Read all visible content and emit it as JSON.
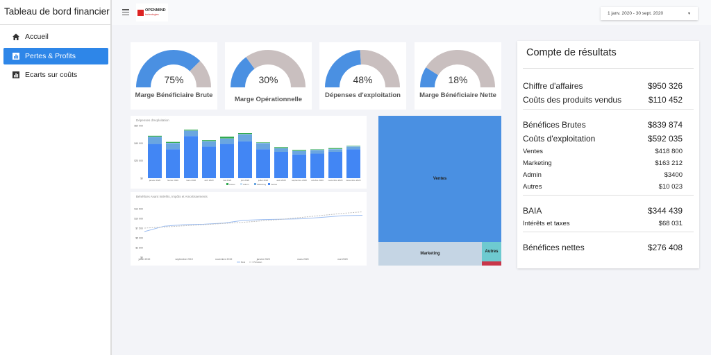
{
  "sidebar": {
    "title": "Tableau de bord financier",
    "items": [
      {
        "label": "Accueil",
        "icon": "home-icon"
      },
      {
        "label": "Pertes & Profits",
        "icon": "bar-chart-icon",
        "active": true
      },
      {
        "label": "Ecarts sur coûts",
        "icon": "bar-chart-icon"
      }
    ]
  },
  "header": {
    "logo_text": "OPENMIND",
    "logo_sub": "technologies",
    "date_range": "1 janv. 2020 - 30 sept. 2020"
  },
  "gauges": [
    {
      "label": "Marge Bénéficiaire Brute",
      "value_label": "75%",
      "value": 75
    },
    {
      "label": "Marge Opérationnelle",
      "value_label": "30%",
      "value": 30
    },
    {
      "label": "Dépenses d'exploitation",
      "value_label": "48%",
      "value": 48
    },
    {
      "label": "Marge Bénéficiaire Nette",
      "value_label": "18%",
      "value": 18
    }
  ],
  "colors": {
    "accent": "#2e86e8",
    "gauge_fill": "#4a90e2",
    "gauge_rest": "#c9bfbf",
    "ventes": "#4286f4",
    "marketing": "#6aa6e0",
    "admin": "#c9e1f5",
    "autres": "#2ea84e"
  },
  "chart_data": [
    {
      "type": "bar",
      "stacked": true,
      "title": "Dépenses d'exploitation",
      "categories": [
        "janvier 2020",
        "février 2020",
        "mars 2020",
        "avril 2020",
        "mai 2020",
        "juin 2020",
        "juillet 2020",
        "août 2020",
        "septembre 2020",
        "octobre 2020",
        "novembre 2020",
        "décembre 2020"
      ],
      "yticks": [
        "$0",
        "$20 000",
        "$40 000",
        "$60 000"
      ],
      "ylim": [
        0,
        60000
      ],
      "legend": "bottom",
      "series": [
        {
          "name": "Ventes",
          "values": [
            39000,
            33000,
            48000,
            36000,
            39000,
            42000,
            33000,
            30000,
            27000,
            28000,
            30000,
            33000
          ]
        },
        {
          "name": "Marketing",
          "values": [
            8000,
            7000,
            6000,
            6000,
            6000,
            8000,
            7000,
            4000,
            4000,
            4000,
            3000,
            3000
          ]
        },
        {
          "name": "Admin",
          "values": [
            300,
            300,
            300,
            300,
            300,
            300,
            300,
            300,
            300,
            300,
            300,
            300
          ]
        },
        {
          "name": "Autres",
          "values": [
            1000,
            1000,
            1000,
            1000,
            2000,
            1000,
            500,
            1000,
            1000,
            500,
            1000,
            500
          ]
        }
      ]
    },
    {
      "type": "line",
      "title": "Bénéfices Avant Intérêts, Impôts et Amortissements",
      "xticks": [
        "juillet 2019",
        "septembre 2019",
        "novembre 2019",
        "janvier 2020",
        "mars 2020",
        "mai 2020"
      ],
      "yticks": [
        "$0",
        "$2 500",
        "$5 000",
        "$7 500",
        "$10 000",
        "$12 500"
      ],
      "ylim": [
        0,
        12500
      ],
      "legend": "bottom",
      "x": [
        "2019-07",
        "2019-08",
        "2019-09",
        "2019-10",
        "2019-11",
        "2019-12",
        "2020-01",
        "2020-02",
        "2020-03",
        "2020-04",
        "2020-05",
        "2020-06"
      ],
      "series": [
        {
          "name": "Réel",
          "values": [
            6600,
            8000,
            8400,
            8500,
            8800,
            9500,
            9700,
            9800,
            9900,
            10300,
            10700,
            10800
          ]
        },
        {
          "name": "Prévision",
          "values": [
            7500,
            7800,
            8100,
            8400,
            8700,
            9000,
            9400,
            9800,
            10300,
            10800,
            11300,
            11700
          ]
        }
      ]
    },
    {
      "type": "treemap",
      "items": [
        {
          "name": "Ventes",
          "value": 418800
        },
        {
          "name": "Marketing",
          "value": 163212
        },
        {
          "name": "Autres",
          "value": 10023
        },
        {
          "name": "Admin",
          "value": 3400
        }
      ]
    }
  ],
  "pl": {
    "title": "Compte de résultats",
    "groups": [
      [
        {
          "label": "Chiffre d'affaires",
          "value": "$950 326",
          "size": "big"
        },
        {
          "label": "Coûts des produits vendus",
          "value": "$110 452",
          "size": "big"
        }
      ],
      [
        {
          "label": "Bénéfices Brutes",
          "value": "$839 874",
          "size": "big"
        },
        {
          "label": "Coûts d'exploitation",
          "value": "$592 035",
          "size": "big"
        },
        {
          "label": "Ventes",
          "value": "$418 800",
          "size": "small"
        },
        {
          "label": "Marketing",
          "value": "$163 212",
          "size": "small"
        },
        {
          "label": "Admin",
          "value": "$3400",
          "size": "small"
        },
        {
          "label": "Autres",
          "value": "$10 023",
          "size": "small"
        }
      ],
      [
        {
          "label": "BAIA",
          "value": "$344 439",
          "size": "big"
        },
        {
          "label": "Intérêts et taxes",
          "value": "$68 031",
          "size": "small"
        }
      ],
      [
        {
          "label": "Bénéfices nettes",
          "value": "$276 408",
          "size": "big"
        }
      ]
    ]
  }
}
